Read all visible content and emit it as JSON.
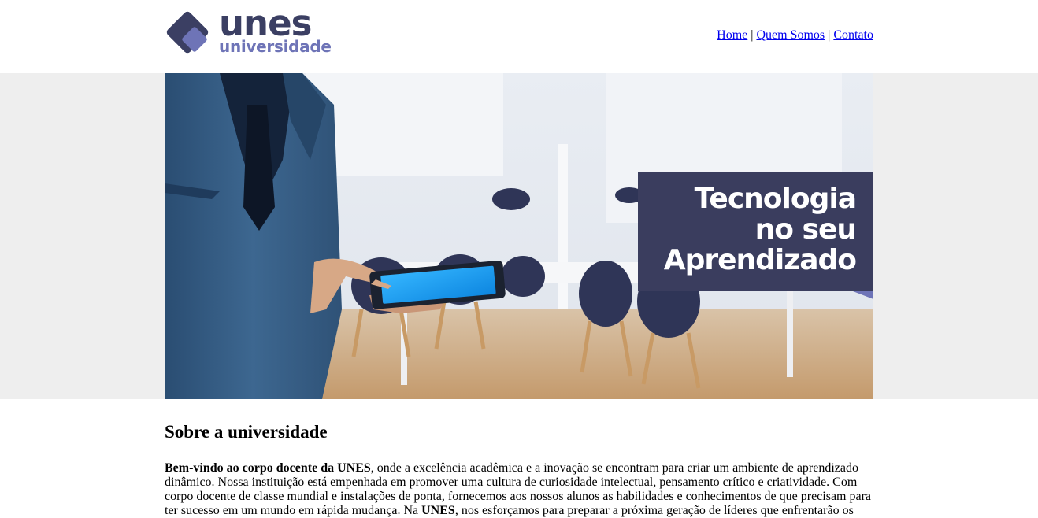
{
  "brand": {
    "name": "unes",
    "sub": "universidade",
    "colors": {
      "primary": "#3b3f63",
      "accent": "#6e74b7"
    }
  },
  "nav": {
    "items": [
      {
        "label": "Home"
      },
      {
        "label": "Quem Somos"
      },
      {
        "label": "Contato"
      }
    ],
    "separator": "|"
  },
  "banner": {
    "caption_line1": "Tecnologia",
    "caption_line2": "no seu",
    "caption_line3": "Aprendizado"
  },
  "about": {
    "title": "Sobre a universidade",
    "lead_bold": "Bem-vindo ao corpo docente da UNES",
    "lead_text": ", onde a excelência acadêmica e a inovação se encontram para criar um ambiente de aprendizado dinâmico. Nossa instituição está empenhada em promover uma cultura de curiosidade intelectual, pensamento crítico e criatividade. Com corpo docente de classe mundial e instalações de ponta, fornecemos aos nossos alunos as habilidades e conhecimentos de que precisam para ter sucesso em um mundo em rápida mudança. Na ",
    "mid_bold": "UNES",
    "tail_text": ", nos esforçamos para preparar a próxima geração de líderes que enfrentarão os"
  }
}
